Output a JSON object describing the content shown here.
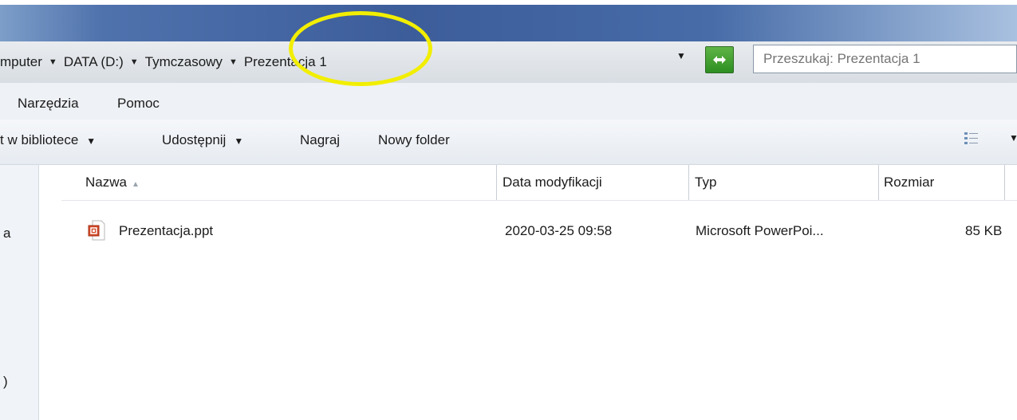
{
  "address": {
    "crumbs": [
      "mputer",
      "DATA (D:)",
      "Tymczasowy",
      "Prezentacja 1"
    ]
  },
  "search": {
    "placeholder": "Przeszukaj: Prezentacja 1"
  },
  "menu": {
    "items": [
      "Narzędzia",
      "Pomoc"
    ]
  },
  "toolbar": {
    "library": "t w bibliotece",
    "share": "Udostępnij",
    "burn": "Nagraj",
    "new_folder": "Nowy folder"
  },
  "nav": {
    "items": [
      "a",
      ")"
    ]
  },
  "columns": {
    "name": "Nazwa",
    "date": "Data modyfikacji",
    "type": "Typ",
    "size": "Rozmiar"
  },
  "files": [
    {
      "name": "Prezentacja.ppt",
      "date": "2020-03-25 09:58",
      "type": "Microsoft PowerPoi...",
      "size": "85 KB",
      "icon": "powerpoint-file-icon"
    }
  ],
  "colors": {
    "highlight": "#f2ee00",
    "refresh": "#3f9c2f"
  }
}
